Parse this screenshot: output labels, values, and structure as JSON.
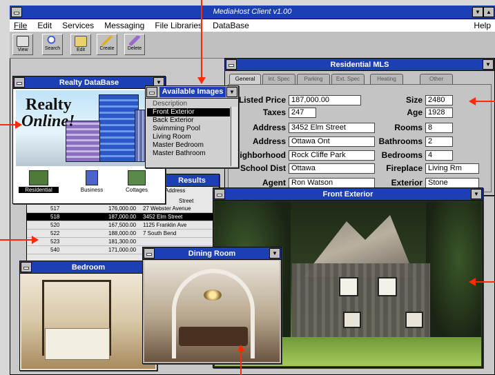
{
  "app": {
    "title": "MediaHost Client v1.00"
  },
  "menu": {
    "file": "File",
    "edit": "Edit",
    "services": "Services",
    "messaging": "Messaging",
    "file_libraries": "File Libraries",
    "database": "DataBase",
    "help": "Help"
  },
  "toolbar": {
    "view": "View",
    "search": "Search",
    "edit": "Edit",
    "create": "Create",
    "delete": "Delete"
  },
  "realty_window": {
    "title": "Realty DataBase",
    "logo_line1": "Realty",
    "logo_line2": "Online!",
    "categories": [
      "Residential",
      "Business",
      "Cottages"
    ]
  },
  "images_dropdown": {
    "title": "Available Images",
    "items": [
      "Description",
      "Front Exterior",
      "Back Exterior",
      "Swimming Pool",
      "Living Room",
      "Master Bedroom",
      "Master Bathroom"
    ],
    "selected": "Front Exterior"
  },
  "listing_window": {
    "title": "Residential MLS",
    "tabs": [
      "General",
      "Int. Spec",
      "Parking",
      "Ext. Spec",
      "Heating",
      "Other"
    ],
    "labels": {
      "price": "Listed Price",
      "taxes": "Taxes",
      "address1": "Address",
      "address2": "Address",
      "neighborhood": "Neighborhood",
      "school": "School Dist",
      "agent": "Agent",
      "size": "Size",
      "age": "Age",
      "rooms": "Rooms",
      "bathrooms": "Bathrooms",
      "bedrooms": "Bedrooms",
      "fireplace": "Fireplace",
      "exterior": "Exterior"
    },
    "values": {
      "price": "187,000.00",
      "taxes": "247",
      "address1": "3452 Elm Street",
      "address2": "Ottawa Ont",
      "neighborhood": "Rock Cliffe Park",
      "school": "Ottawa",
      "agent": "Ron Watson",
      "size": "2480",
      "age": "1928",
      "rooms": "8",
      "bathrooms": "2",
      "bedrooms": "4",
      "fireplace": "Living Rm",
      "exterior": "Stone"
    }
  },
  "results_window": {
    "title": "Results",
    "col_address": "Address",
    "rows": [
      {
        "id": "517",
        "price": "176,000.00",
        "address": "27 Webster Avenue"
      },
      {
        "id": "518",
        "price": "187,000.00",
        "address": "3452 Elm Street"
      },
      {
        "id": "520",
        "price": "167,500.00",
        "address": "1125 Franklin Ave"
      },
      {
        "id": "522",
        "price": "188,000.00",
        "address": "7 South Bend"
      },
      {
        "id": "523",
        "price": "181,300.00",
        "address": ""
      },
      {
        "id": "540",
        "price": "171,000.00",
        "address": ""
      }
    ],
    "top_fragment": "Street"
  },
  "front_exterior": {
    "title": "Front Exterior"
  },
  "bedroom": {
    "title": "Bedroom"
  },
  "dining": {
    "title": "Dining Room"
  },
  "colors": {
    "titlebar": "#1c3fb4",
    "annotation_arrow": "#ff2a00"
  }
}
